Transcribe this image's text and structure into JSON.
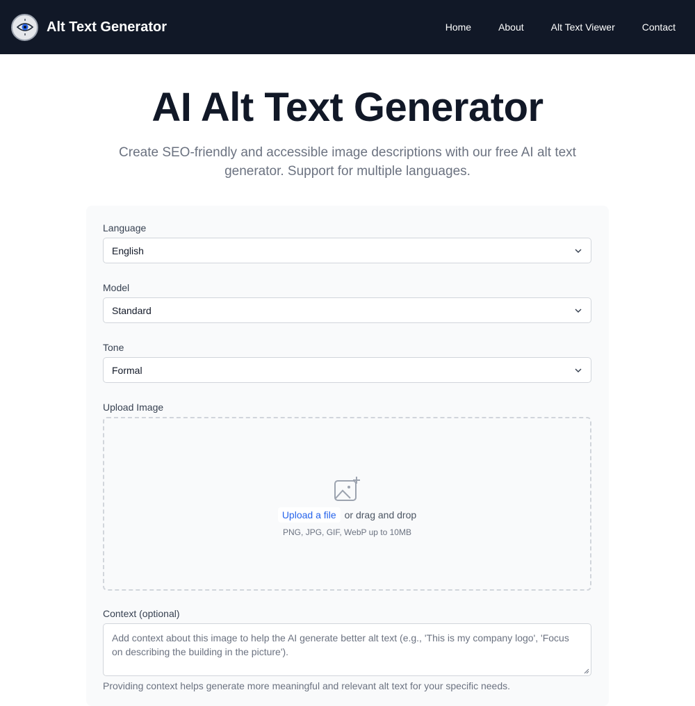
{
  "nav": {
    "brand": "Alt Text Generator",
    "links": [
      "Home",
      "About",
      "Alt Text Viewer",
      "Contact"
    ]
  },
  "hero": {
    "title": "AI Alt Text Generator",
    "subtitle": "Create SEO-friendly and accessible image descriptions with our free AI alt text generator. Support for multiple languages."
  },
  "form": {
    "language": {
      "label": "Language",
      "value": "English"
    },
    "model": {
      "label": "Model",
      "value": "Standard"
    },
    "tone": {
      "label": "Tone",
      "value": "Formal"
    },
    "upload": {
      "label": "Upload Image",
      "link": "Upload a file",
      "drag_text": "or drag and drop",
      "hint": "PNG, JPG, GIF, WebP up to 10MB"
    },
    "context": {
      "label": "Context (optional)",
      "placeholder": "Add context about this image to help the AI generate better alt text (e.g., 'This is my company logo', 'Focus on describing the building in the picture').",
      "helper": "Providing context helps generate more meaningful and relevant alt text for your specific needs."
    }
  },
  "colors": {
    "navbar_bg": "#111827",
    "accent": "#2563eb",
    "card_bg": "#f9fafb"
  },
  "icons": [
    "eye-logo-icon",
    "chevron-down-icon",
    "image-add-icon"
  ]
}
